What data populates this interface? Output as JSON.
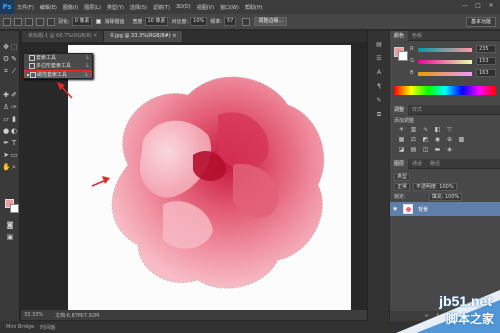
{
  "app": {
    "logo": "Ps"
  },
  "menubar": {
    "items": [
      "文件(F)",
      "编辑(E)",
      "图像(I)",
      "图层(L)",
      "类型(Y)",
      "选择(S)",
      "滤镜(T)",
      "3D(D)",
      "视图(V)",
      "窗口(W)",
      "帮助(H)"
    ]
  },
  "window_controls": {
    "minimize": "—",
    "maximize": "□",
    "close": "✕"
  },
  "options": {
    "feather_label": "羽化:",
    "feather_value": "0 像素",
    "antialias_label": "消除锯齿",
    "style_label": "宽度",
    "style_value": "10 像素",
    "contrast_label": "对比度:",
    "contrast_value": "10%",
    "frequency_label": "频率:",
    "frequency_value": "57",
    "refine_button": "调整边缘...",
    "workspace": "基本功能"
  },
  "tabs": [
    {
      "label": "未标题-1 @ 66.7%(RGB/8) ×",
      "active": false
    },
    {
      "label": "0.jpg @ 33.3%(RGB/8#) ×",
      "active": true
    }
  ],
  "flyout": {
    "items": [
      {
        "label": "套索工具",
        "key": "L",
        "selected": false
      },
      {
        "label": "多边形套索工具",
        "key": "L",
        "selected": false
      },
      {
        "label": "磁性套索工具",
        "key": "L",
        "selected": true
      }
    ]
  },
  "status": {
    "zoom": "33.33%",
    "doc": "文档:6.87M/7.92M"
  },
  "bottom": {
    "mini_bridge": "Mini Bridge",
    "timeline": "时间轴"
  },
  "color_panel": {
    "tabs": [
      "颜色",
      "色板"
    ],
    "r": "235",
    "g": "153",
    "b": "163",
    "r_label": "R",
    "g_label": "G",
    "b_label": "B",
    "fg_color": "#ef9a9f"
  },
  "adjust_panel": {
    "tabs": [
      "调整",
      "样式"
    ],
    "label": "添加调整"
  },
  "layers_panel": {
    "tabs": [
      "图层",
      "通道",
      "路径"
    ],
    "kind": "类型",
    "blend": "正常",
    "opacity": "不透明度: 100%",
    "lock": "锁定:",
    "fill": "填充: 100%",
    "layer_name": "背景"
  },
  "watermark": {
    "main": "jb51.net",
    "sub": "脚本之家"
  }
}
